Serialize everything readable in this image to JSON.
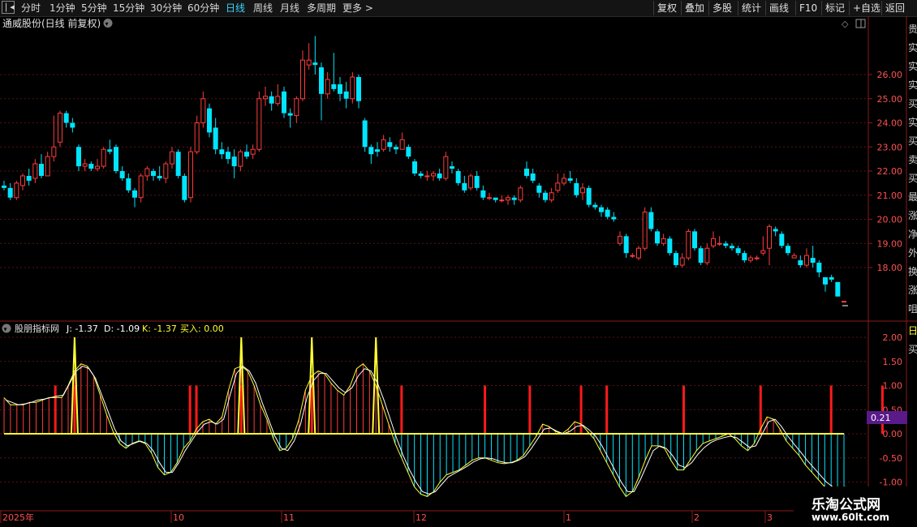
{
  "toolbar": {
    "periods": [
      "分时",
      "1分钟",
      "5分钟",
      "15分钟",
      "30分钟",
      "60分钟",
      "日线",
      "周线",
      "月线",
      "多周期",
      "更多 >"
    ],
    "active_period": "日线",
    "right_buttons": [
      "复权",
      "叠加",
      "多股",
      "统计",
      "画线",
      "F10",
      "标记",
      "+自选",
      "返回"
    ]
  },
  "main_chart": {
    "title": "通威股份(日线 前复权)",
    "y_ticks": [
      "26.00",
      "25.00",
      "24.00",
      "23.00",
      "22.00",
      "21.00",
      "20.00",
      "19.00",
      "18.00"
    ],
    "y_values": [
      26,
      25,
      24,
      23,
      22,
      21,
      20,
      19,
      18
    ]
  },
  "indicator": {
    "name": "股朋指标网",
    "j": "J: -1.37",
    "d": "D: -1.09",
    "k": "K: -1.37",
    "buy": "买入: 0.00",
    "y_ticks": [
      "2.00",
      "1.50",
      "1.00",
      "0.50",
      "0.00",
      "-0.50",
      "-1.00"
    ],
    "y_values": [
      2,
      1.5,
      1,
      0.5,
      0,
      -0.5,
      -1
    ],
    "current_badge": "0.21"
  },
  "x_axis": {
    "labels": [
      "2025年",
      "10",
      "11",
      "12",
      "1",
      "2",
      "3"
    ]
  },
  "right_panel_text": [
    "贵",
    "实",
    "实",
    "实",
    "买",
    "实",
    "买",
    "卖",
    "买",
    "最",
    "涨",
    "净",
    "外",
    "换",
    "涨",
    "咀"
  ],
  "right_panel_text2": [
    "日",
    "买"
  ],
  "watermark": {
    "title": "乐淘公式网",
    "url": "www.60lt.com"
  },
  "colors": {
    "up": "#ff3c3c",
    "down": "#00e5ff",
    "accent": "#39d5ff",
    "signal": "#ff1a1a",
    "j_line": "#ffff33",
    "d_line": "#ffffff",
    "badge": "#5a1a8a"
  },
  "candles": [
    [
      21.4,
      21.3,
      21.6,
      21.2
    ],
    [
      21.3,
      20.9,
      21.5,
      20.8
    ],
    [
      20.9,
      21.5,
      21.6,
      20.8
    ],
    [
      21.4,
      21.8,
      21.9,
      21.2
    ],
    [
      21.8,
      21.6,
      22.1,
      21.4
    ],
    [
      21.7,
      22.3,
      22.5,
      21.5
    ],
    [
      22.3,
      21.8,
      22.7,
      21.7
    ],
    [
      21.8,
      22.6,
      22.8,
      21.8
    ],
    [
      22.6,
      23.0,
      24.3,
      22.4
    ],
    [
      23.2,
      24.4,
      24.5,
      23.0
    ],
    [
      24.4,
      24.0,
      24.5,
      23.8
    ],
    [
      24.0,
      23.8,
      24.2,
      23.6
    ],
    [
      23.0,
      22.2,
      23.1,
      22.0
    ],
    [
      22.2,
      22.3,
      22.5,
      22.0
    ],
    [
      22.3,
      22.1,
      22.4,
      22.0
    ],
    [
      22.1,
      22.2,
      22.5,
      22.0
    ],
    [
      22.2,
      22.9,
      23.0,
      22.1
    ],
    [
      22.9,
      22.8,
      23.3,
      22.7
    ],
    [
      23.0,
      22.0,
      23.1,
      21.9
    ],
    [
      22.0,
      21.7,
      22.2,
      21.6
    ],
    [
      21.7,
      21.2,
      21.9,
      21.1
    ],
    [
      21.2,
      20.9,
      21.3,
      20.5
    ],
    [
      20.9,
      21.8,
      21.9,
      20.7
    ],
    [
      21.8,
      22.1,
      22.2,
      21.6
    ],
    [
      22.0,
      21.8,
      22.1,
      21.6
    ],
    [
      21.8,
      21.7,
      22.2,
      21.6
    ],
    [
      21.7,
      22.3,
      22.4,
      21.5
    ],
    [
      22.3,
      22.8,
      23.0,
      22.1
    ],
    [
      22.8,
      21.8,
      22.9,
      21.7
    ],
    [
      21.8,
      20.8,
      21.9,
      20.7
    ],
    [
      20.9,
      22.8,
      23.0,
      20.7
    ],
    [
      22.8,
      24.0,
      24.3,
      22.7
    ],
    [
      24.0,
      25.0,
      25.3,
      23.8
    ],
    [
      24.6,
      23.6,
      24.8,
      23.4
    ],
    [
      23.8,
      22.9,
      24.2,
      22.7
    ],
    [
      22.9,
      22.7,
      23.2,
      22.5
    ],
    [
      22.8,
      22.5,
      23.0,
      22.3
    ],
    [
      22.6,
      22.2,
      22.9,
      21.7
    ],
    [
      22.2,
      22.8,
      22.9,
      22.0
    ],
    [
      22.8,
      22.6,
      23.1,
      22.5
    ],
    [
      22.7,
      22.9,
      23.1,
      22.5
    ],
    [
      22.9,
      25.0,
      25.3,
      22.8
    ],
    [
      25.0,
      25.1,
      25.5,
      24.7
    ],
    [
      25.1,
      24.8,
      25.3,
      24.5
    ],
    [
      24.8,
      25.1,
      25.6,
      24.7
    ],
    [
      25.3,
      24.4,
      25.5,
      24.2
    ],
    [
      24.4,
      24.3,
      24.6,
      23.8
    ],
    [
      24.3,
      25.0,
      25.1,
      24.0
    ],
    [
      25.0,
      26.6,
      27.0,
      24.9
    ],
    [
      26.4,
      26.6,
      27.3,
      26.2
    ],
    [
      26.5,
      26.4,
      27.6,
      26.0
    ],
    [
      26.3,
      25.2,
      26.5,
      24.1
    ],
    [
      25.2,
      25.8,
      26.1,
      25.0
    ],
    [
      25.6,
      25.4,
      26.9,
      25.3
    ],
    [
      25.6,
      25.2,
      25.9,
      24.9
    ],
    [
      25.3,
      25.0,
      25.7,
      24.6
    ],
    [
      25.0,
      25.9,
      26.1,
      24.8
    ],
    [
      25.9,
      24.9,
      26.0,
      24.6
    ],
    [
      24.1,
      23.0,
      24.2,
      22.8
    ],
    [
      23.0,
      22.7,
      23.1,
      22.3
    ],
    [
      22.9,
      22.8,
      23.2,
      22.6
    ],
    [
      22.9,
      23.3,
      23.5,
      22.8
    ],
    [
      23.2,
      23.0,
      23.4,
      22.8
    ],
    [
      23.0,
      22.9,
      23.1,
      22.7
    ],
    [
      22.9,
      23.3,
      23.6,
      22.9
    ],
    [
      23.0,
      22.6,
      23.1,
      22.5
    ],
    [
      22.4,
      21.9,
      22.5,
      21.8
    ],
    [
      21.9,
      21.8,
      22.0,
      21.7
    ],
    [
      21.8,
      21.8,
      22.0,
      21.6
    ],
    [
      21.8,
      21.9,
      22.0,
      21.6
    ],
    [
      21.9,
      21.7,
      22.1,
      21.6
    ],
    [
      21.7,
      22.6,
      22.8,
      21.6
    ],
    [
      22.2,
      22.1,
      22.4,
      21.9
    ],
    [
      22.0,
      21.5,
      22.1,
      21.4
    ],
    [
      21.5,
      21.2,
      21.8,
      21.1
    ],
    [
      21.3,
      21.8,
      21.9,
      21.2
    ],
    [
      21.8,
      21.3,
      22.0,
      21.2
    ],
    [
      21.2,
      20.9,
      21.4,
      20.8
    ],
    [
      20.9,
      20.9,
      21.1,
      20.8
    ],
    [
      20.9,
      20.8,
      20.9,
      20.7
    ],
    [
      20.8,
      20.8,
      21.0,
      20.7
    ],
    [
      20.8,
      20.9,
      21.0,
      20.6
    ],
    [
      20.9,
      20.8,
      21.0,
      20.6
    ],
    [
      20.8,
      21.3,
      21.4,
      20.7
    ],
    [
      22.1,
      21.8,
      22.4,
      21.7
    ],
    [
      21.9,
      21.6,
      22.1,
      21.5
    ],
    [
      21.4,
      21.1,
      21.5,
      20.9
    ],
    [
      21.1,
      20.8,
      21.2,
      20.7
    ],
    [
      20.8,
      21.1,
      21.3,
      20.7
    ],
    [
      21.2,
      21.5,
      21.9,
      21.1
    ],
    [
      21.5,
      21.7,
      21.9,
      21.4
    ],
    [
      21.7,
      21.6,
      22.0,
      21.5
    ],
    [
      21.5,
      21.0,
      21.7,
      20.9
    ],
    [
      21.1,
      21.3,
      21.5,
      20.8
    ],
    [
      21.3,
      20.6,
      21.4,
      20.5
    ],
    [
      20.6,
      20.5,
      20.7,
      20.4
    ],
    [
      20.5,
      20.3,
      20.6,
      20.1
    ],
    [
      20.4,
      20.1,
      20.5,
      20.0
    ],
    [
      20.1,
      20.0,
      20.3,
      19.9
    ],
    [
      19.0,
      19.3,
      19.5,
      18.9
    ],
    [
      19.3,
      18.6,
      19.4,
      18.4
    ],
    [
      18.5,
      18.5,
      18.6,
      18.4
    ],
    [
      18.4,
      18.8,
      18.9,
      18.3
    ],
    [
      18.8,
      20.3,
      20.5,
      18.7
    ],
    [
      20.3,
      19.6,
      20.5,
      19.5
    ],
    [
      19.5,
      19.0,
      19.6,
      18.9
    ],
    [
      19.0,
      19.2,
      19.4,
      18.9
    ],
    [
      19.2,
      18.6,
      19.3,
      18.5
    ],
    [
      18.6,
      18.1,
      18.7,
      18.0
    ],
    [
      18.1,
      18.4,
      18.6,
      18.0
    ],
    [
      18.4,
      19.5,
      19.6,
      18.3
    ],
    [
      19.5,
      18.8,
      19.6,
      18.7
    ],
    [
      18.8,
      18.2,
      18.9,
      18.1
    ],
    [
      18.2,
      18.8,
      19.0,
      18.1
    ],
    [
      18.9,
      19.2,
      19.5,
      18.8
    ],
    [
      19.0,
      19.0,
      19.3,
      18.9
    ],
    [
      19.0,
      18.9,
      19.1,
      18.8
    ],
    [
      18.9,
      18.8,
      19.0,
      18.7
    ],
    [
      18.8,
      18.6,
      18.9,
      18.5
    ],
    [
      18.6,
      18.3,
      18.7,
      18.2
    ],
    [
      18.3,
      18.4,
      18.5,
      18.2
    ],
    [
      18.4,
      18.4,
      18.5,
      18.3
    ],
    [
      18.6,
      18.7,
      19.3,
      18.5
    ],
    [
      18.8,
      19.7,
      19.8,
      18.1
    ],
    [
      19.6,
      19.5,
      19.7,
      19.3
    ],
    [
      19.4,
      18.9,
      19.5,
      18.8
    ],
    [
      18.9,
      18.6,
      19.0,
      18.5
    ],
    [
      18.4,
      18.5,
      18.6,
      18.4
    ],
    [
      18.3,
      18.1,
      18.5,
      18.0
    ],
    [
      18.1,
      18.5,
      18.8,
      18.0
    ],
    [
      18.4,
      18.2,
      18.9,
      18.0
    ],
    [
      18.2,
      17.8,
      18.3,
      17.6
    ],
    [
      17.6,
      17.3,
      17.6,
      17.0
    ],
    [
      17.6,
      17.5,
      17.7,
      17.4
    ],
    [
      17.4,
      16.8,
      17.4,
      16.8
    ],
    [
      16.6,
      16.6,
      16.6,
      16.6
    ]
  ],
  "indicator_series": {
    "hist": [
      0.75,
      0.6,
      0.6,
      0.6,
      0.65,
      0.65,
      0.7,
      0.75,
      0.75,
      0.75,
      1.0,
      1.3,
      1.45,
      1.4,
      1.2,
      0.8,
      0.4,
      0.05,
      -0.2,
      -0.3,
      -0.2,
      -0.15,
      -0.2,
      -0.4,
      -0.7,
      -0.85,
      -0.8,
      -0.6,
      -0.3,
      -0.15,
      0.1,
      0.25,
      0.3,
      0.2,
      0.35,
      0.9,
      1.35,
      1.4,
      1.3,
      1.0,
      0.6,
      0.3,
      -0.1,
      -0.35,
      -0.3,
      -0.1,
      0.3,
      0.9,
      1.2,
      1.3,
      1.25,
      1.05,
      0.9,
      0.8,
      1.0,
      1.35,
      1.45,
      1.3,
      1.0,
      0.6,
      0.2,
      -0.2,
      -0.5,
      -0.8,
      -1.1,
      -1.25,
      -1.3,
      -1.2,
      -1.0,
      -0.85,
      -0.8,
      -0.75,
      -0.65,
      -0.55,
      -0.5,
      -0.5,
      -0.55,
      -0.6,
      -0.62,
      -0.6,
      -0.55,
      -0.45,
      -0.25,
      -0.05,
      0.2,
      0.15,
      0.05,
      0.0,
      0.1,
      0.25,
      0.2,
      0.05,
      -0.1,
      -0.35,
      -0.6,
      -0.85,
      -1.1,
      -1.3,
      -1.2,
      -0.9,
      -0.55,
      -0.25,
      -0.25,
      -0.3,
      -0.55,
      -0.75,
      -0.75,
      -0.55,
      -0.35,
      -0.2,
      -0.15,
      -0.1,
      -0.05,
      0.0,
      -0.1,
      -0.25,
      -0.35,
      -0.2,
      0.1,
      0.35,
      0.3,
      0.1,
      -0.15,
      -0.3,
      -0.45,
      -0.65,
      -0.8,
      -0.95,
      -1.1,
      -1.2,
      -1.25,
      -1.3
    ],
    "d": [
      0.7,
      0.65,
      0.6,
      0.62,
      0.65,
      0.7,
      0.72,
      0.75,
      0.78,
      0.8,
      1.05,
      1.3,
      1.4,
      1.35,
      1.15,
      0.8,
      0.45,
      0.1,
      -0.15,
      -0.25,
      -0.2,
      -0.15,
      -0.2,
      -0.35,
      -0.6,
      -0.8,
      -0.8,
      -0.6,
      -0.35,
      -0.15,
      0.05,
      0.2,
      0.25,
      0.2,
      0.3,
      0.8,
      1.25,
      1.4,
      1.3,
      1.05,
      0.65,
      0.3,
      -0.05,
      -0.3,
      -0.35,
      -0.15,
      0.2,
      0.75,
      1.1,
      1.25,
      1.25,
      1.1,
      0.95,
      0.85,
      0.95,
      1.2,
      1.35,
      1.3,
      1.05,
      0.7,
      0.3,
      -0.1,
      -0.45,
      -0.75,
      -1.0,
      -1.2,
      -1.25,
      -1.2,
      -1.05,
      -0.9,
      -0.82,
      -0.75,
      -0.67,
      -0.58,
      -0.52,
      -0.5,
      -0.52,
      -0.57,
      -0.6,
      -0.6,
      -0.55,
      -0.47,
      -0.3,
      -0.1,
      0.1,
      0.12,
      0.05,
      0.0,
      0.05,
      0.15,
      0.18,
      0.08,
      -0.05,
      -0.25,
      -0.5,
      -0.75,
      -1.0,
      -1.2,
      -1.2,
      -0.95,
      -0.65,
      -0.35,
      -0.25,
      -0.3,
      -0.45,
      -0.65,
      -0.7,
      -0.6,
      -0.42,
      -0.28,
      -0.18,
      -0.12,
      -0.08,
      -0.05,
      -0.08,
      -0.18,
      -0.28,
      -0.25,
      0.0,
      0.25,
      0.3,
      0.15,
      -0.05,
      -0.22,
      -0.38,
      -0.55,
      -0.7,
      -0.85,
      -1.0,
      -1.1,
      -1.15,
      -1.09
    ],
    "signals": [
      8,
      11,
      29,
      30,
      37,
      48,
      62,
      75,
      82,
      90,
      94,
      106,
      118,
      129,
      137
    ],
    "spikes": [
      11,
      37,
      48,
      58
    ]
  }
}
